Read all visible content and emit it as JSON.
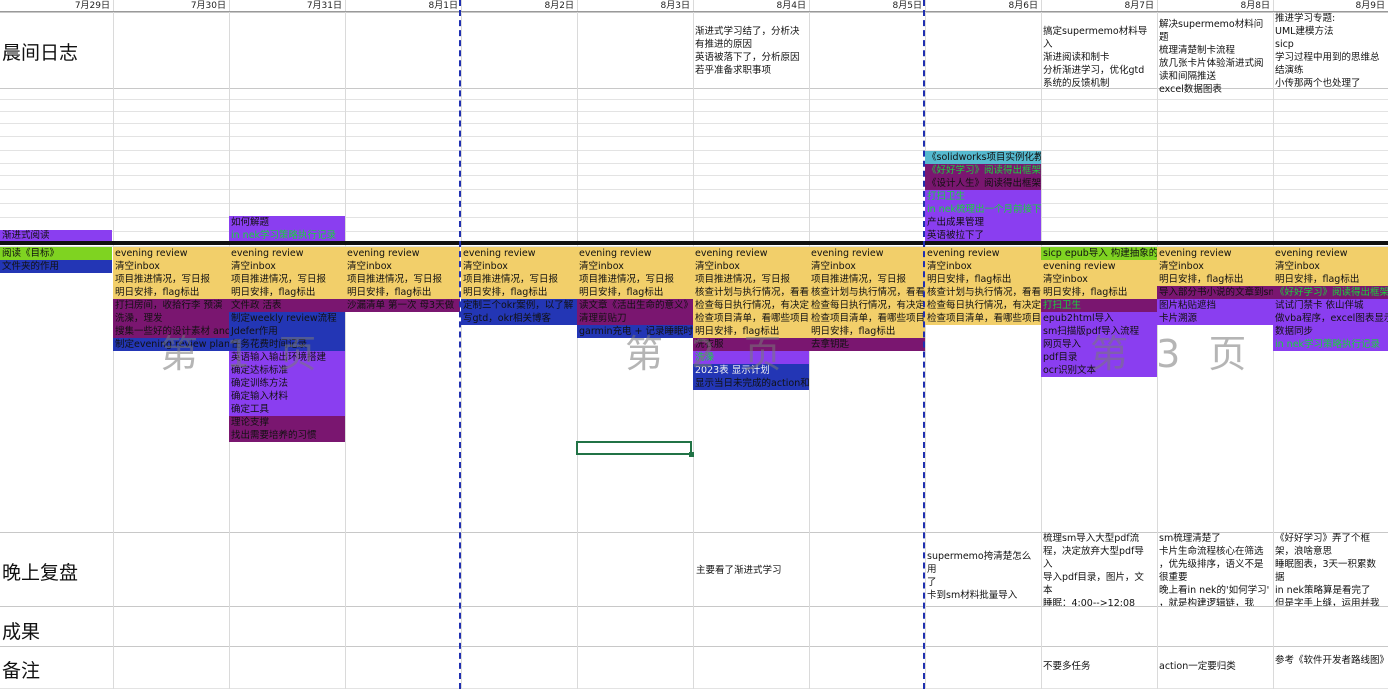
{
  "dates": [
    "7月29日",
    "7月30日",
    "7月31日",
    "8月1日",
    "8月2日",
    "8月3日",
    "8月4日",
    "8月5日",
    "8月6日",
    "8月7日",
    "8月8日",
    "8月9日"
  ],
  "row_labels": {
    "morning": "晨间日志",
    "evening": "晚上复盘",
    "result": "成果",
    "remark": "备注"
  },
  "watermarks": [
    "第 1 页",
    "第 2 页",
    "第 3 页"
  ],
  "morning_notes": {
    "aug4": [
      "渐进式学习结了，分析决",
      "有推进的原因",
      "英语被落下了，分析原因",
      "若乎准备求职事项"
    ],
    "aug7": [
      "搞定supermemo材料导入",
      "渐进阅读和制卡",
      "分析渐进学习，优化gtd",
      "系统的反馈机制"
    ],
    "aug8": [
      "解决supermemo材料问题",
      "梳理清楚制卡流程",
      "放几张卡片体验渐进式阅",
      "读和间隔推送",
      "excel数据图表"
    ],
    "aug9": [
      "推进学习专题:",
      "UML建模方法",
      "sicp",
      "学习过程中用到的思维总",
      "结演练",
      "小传那两个也处理了"
    ]
  },
  "upper_blocks": {
    "jul29_reading": "渐进式阅读",
    "jul31": [
      "如何解题",
      "in nek学习策略执行记录"
    ],
    "aug6": [
      "《solidworks项目实例化教程》",
      "《好好学习》阅读得出框架，并准备提问",
      "《设计人生》阅读得出框架并设计实践",
      "打扫卫生",
      "in nek梳理出一个月前接下的原因",
      "产出成果管理",
      "英语被拉下了"
    ]
  },
  "jul29_lower": [
    "阅读《目标》",
    "文件夹的作用"
  ],
  "evening_common": [
    "evening review",
    "清空inbox",
    "项目推进情况，写日报",
    "明日安排，flag标出"
  ],
  "jul30_extra": [
    "打扫房间，收拾行李 预演",
    "洗澡，理发",
    "搜集一些好的设计素材 and",
    "制定evening review  plan"
  ],
  "jul31_extra": [
    "文件政 活表",
    "制定weekly review流程",
    "Jdefer作用",
    "任务花费时间记录",
    "英语输入输出环境搭建",
    "确定达标标准",
    "确定训练方法",
    "确定输入材料",
    "确定工具",
    "理论支撑",
    "找出需要培养的习惯"
  ],
  "aug1_extra": [
    "沙漏清单 第一次 母3天做"
  ],
  "aug2_extra": [
    "定制三个okr案例，以了解",
    "写gtd，okr相关博客"
  ],
  "aug3_extra": [
    "读文章《活出生命的意义》",
    "清理剪贴刀",
    "garmin充电 + 记录睡眠时"
  ],
  "aug4_list": [
    "evening review",
    "清空inbox",
    "项目推进情况，写日报",
    "核查计划与执行情况，看看",
    "检查每日执行情况，有决定",
    "检查项目清单，看哪些项目",
    "明日安排，flag标出",
    "洗衣服",
    "洗澡",
    "2023表 显示计划",
    "显示当日未完成的action和后续状态"
  ],
  "aug5_list": [
    "evening review",
    "清空inbox",
    "项目推进情况，写日报",
    "核查计划与执行情况，看看",
    "检查每日执行情况，有决定",
    "检查项目清单，看哪些项目",
    "明日安排，flag标出",
    "去拿钥匙"
  ],
  "aug6_list": [
    "evening review",
    "清空inbox",
    "明日安排，flag标出",
    "核查计划与执行情况，看看",
    "检查每日执行情况，有决定",
    "检查项目清单，看哪些项目"
  ],
  "aug7_list": [
    "sicp epub导入 构建抽象的",
    "evening review",
    "清空inbox",
    "明日安排，flag标出",
    "打扫卫生",
    "epub2html导入",
    "sm扫描版pdf导入流程",
    "网页导入",
    "pdf目录",
    "ocr识别文本"
  ],
  "aug8_list": [
    "evening review",
    "清空inbox",
    "明日安排，flag标出",
    "导入部分书小说的文章到sm",
    "图片粘贴遮挡",
    "卡片溯源"
  ],
  "aug9_list": [
    "evening review",
    "清空inbox",
    "明日安排，flag标出",
    "《好好学习》阅读得出框架",
    "试试门禁卡 依山伴城",
    "做vba程序，excel图表显示",
    "数据同步",
    "in nek学习策略执行记录"
  ],
  "evening_notes": {
    "aug4": "主要看了渐进式学习",
    "aug6": [
      "supermemo挎清楚怎么用",
      "了",
      "卡到sm材料批量导入"
    ],
    "aug7": [
      "梳理sm导入大型pdf流",
      "程，决定放弃大型pdf导",
      "入",
      "导入pdf目录，图片，文",
      "本",
      "睡眠：4:00-->12:08"
    ],
    "aug8": [
      "sm梳理清楚了",
      "卡片生命流程核心在筛选",
      "，优先级排序，语义不是",
      "很重要",
      "晚上看in nek的'如何学习'",
      "，就是构建逻辑链，我"
    ],
    "aug9": [
      "《好好学习》弄了个框",
      "架，浪啥意思",
      "睡眠图表，3天一积累数",
      "据",
      "in nek策略算是看完了",
      "但是字手上缝，运用并我"
    ]
  },
  "remarks": {
    "aug7": "不要多任务",
    "aug8": "action一定要归类",
    "aug9": "参考《软件开发者路线图》"
  }
}
